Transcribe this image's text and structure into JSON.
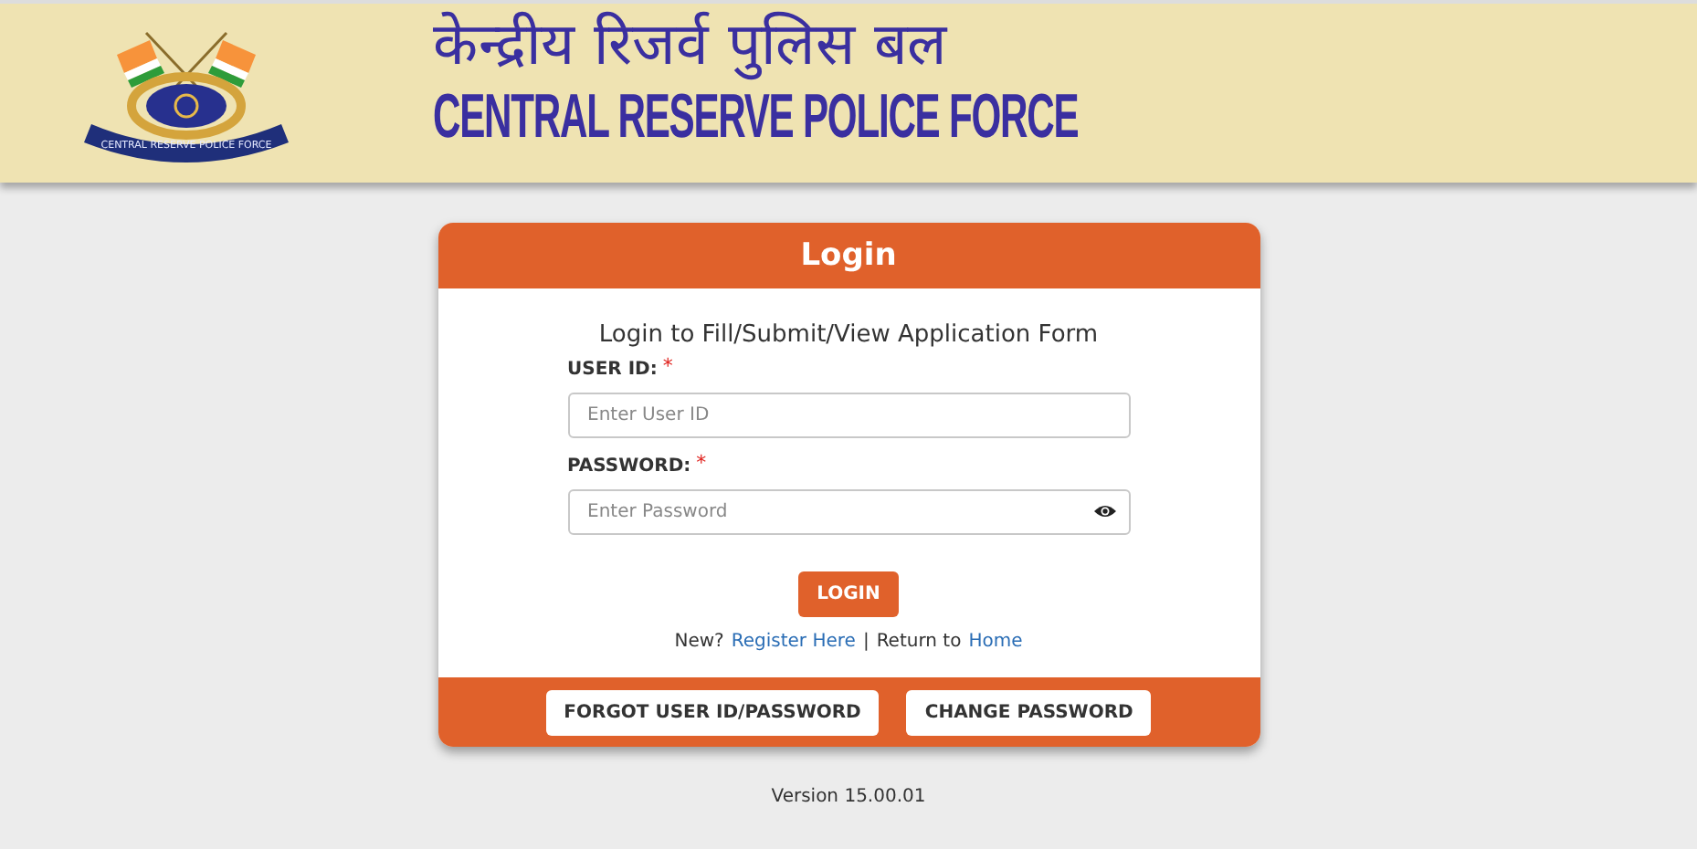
{
  "header": {
    "title_hindi": "केन्द्रीय रिजर्व पुलिस बल",
    "title_english": "CENTRAL RESERVE POLICE FORCE",
    "emblem_text": "CENTRAL RESERVE POLICE FORCE"
  },
  "login_card": {
    "title": "Login",
    "subtitle": "Login to Fill/Submit/View Application Form",
    "fields": [
      {
        "label": "USER ID:",
        "required_mark": "*",
        "placeholder": "Enter User ID",
        "kind": "text"
      },
      {
        "label": "PASSWORD:",
        "required_mark": "*",
        "placeholder": "Enter Password",
        "kind": "password"
      }
    ],
    "submit": "LOGIN",
    "links": {
      "new_text": "New?",
      "register": "Register Here",
      "separator": "|",
      "return_text": "Return to",
      "home": "Home"
    },
    "footer_buttons": [
      "FORGOT USER ID/PASSWORD",
      "CHANGE PASSWORD"
    ]
  },
  "version": "Version 15.00.01"
}
